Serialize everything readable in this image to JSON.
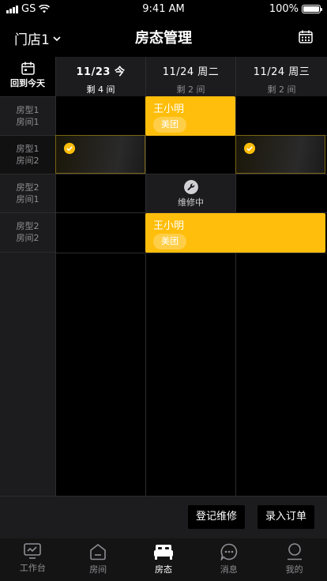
{
  "status_bar": {
    "carrier": "GS",
    "time": "9:41 AM",
    "battery": "100%"
  },
  "nav": {
    "store": "门店1",
    "title": "房态管理"
  },
  "schedule": {
    "today_button": "回到今天",
    "days": [
      {
        "date": "11/23 今",
        "remaining": "剩 4 间"
      },
      {
        "date": "11/24 周二",
        "remaining": "剩 2 间"
      },
      {
        "date": "11/24 周三",
        "remaining": "剩 2 间"
      }
    ],
    "rooms": [
      {
        "type": "房型1",
        "room": "房间1"
      },
      {
        "type": "房型1",
        "room": "房间2"
      },
      {
        "type": "房型2",
        "room": "房间1"
      },
      {
        "type": "房型2",
        "room": "房间2"
      }
    ],
    "bookings": [
      {
        "guest": "王小明",
        "channel": "美团"
      },
      {
        "guest": "王小明",
        "channel": "美团"
      }
    ],
    "maintenance_label": "维修中",
    "accent_color": "#ffbe0b"
  },
  "actions": {
    "maintenance": "登记维修",
    "order": "录入订单"
  },
  "tabbar": [
    {
      "label": "工作台",
      "icon": "monitor-icon"
    },
    {
      "label": "房间",
      "icon": "room-icon"
    },
    {
      "label": "房态",
      "icon": "bed-icon",
      "active": true
    },
    {
      "label": "消息",
      "icon": "message-icon"
    },
    {
      "label": "我的",
      "icon": "profile-icon"
    }
  ]
}
